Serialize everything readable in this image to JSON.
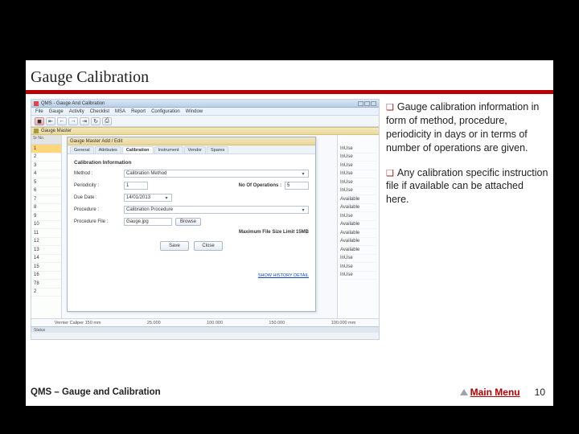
{
  "slide": {
    "title": "Gauge Calibration",
    "footer_text": "QMS – Gauge and Calibration",
    "main_menu": "Main Menu",
    "page_number": "10"
  },
  "notes": {
    "p1": "Gauge calibration information in form of method, procedure, periodicity in days or in terms of number of operations are given.",
    "p2": "Any calibration specific instruction file if available can be attached here."
  },
  "app": {
    "window_title": "QMS - Gauge And Calibration",
    "menu": [
      "File",
      "Gauge",
      "Activity",
      "Checklist",
      "MSA",
      "Report",
      "Configuration",
      "Window"
    ],
    "child_title": "Gauge Master",
    "status": "Status"
  },
  "left": {
    "header": "Sr No.",
    "rows": [
      "1",
      "2",
      "3",
      "4",
      "5",
      "6",
      "7",
      "8",
      "9",
      "10",
      "11",
      "12",
      "13",
      "14",
      "15",
      "16",
      "78",
      "2"
    ]
  },
  "dialog": {
    "title": "Gauge Master Add / Edit",
    "tabs": [
      "General",
      "Attributes",
      "Calibration",
      "Instrument",
      "Vendor",
      "Spares"
    ],
    "active_tab": 2,
    "section": "Calibration Information",
    "method_label": "Method :",
    "method_value": "Calibration Method",
    "periodicity_label": "Periodicity :",
    "periodicity_value": "1",
    "noops_label": "No Of Operations :",
    "noops_value": "5",
    "duedate_label": "Due Date :",
    "duedate_value": "14/01/2013",
    "procedure_label": "Procedure :",
    "procedure_value": "Calibration Procedure",
    "procfile_label": "Procedure File :",
    "procfile_value": "Gauge.jpg",
    "browse": "Browse",
    "filesize": "Maximum File Size Limit 15MB",
    "save": "Save",
    "close": "Close",
    "history_link": "SHOW HISTORY DETAIL"
  },
  "rightcol": {
    "items": [
      "InUse",
      "InUse",
      "InUse",
      "InUse",
      "InUse",
      "InUse",
      "Available",
      "Available",
      "InUse",
      "Available",
      "Available",
      "Available",
      "Available",
      "InUse",
      "InUse",
      "InUse"
    ]
  },
  "axis": {
    "caption": "Vernier Caliper 150 mm",
    "ticks": [
      "25.000",
      "100.000",
      "150.000",
      "100.000 mm"
    ]
  }
}
